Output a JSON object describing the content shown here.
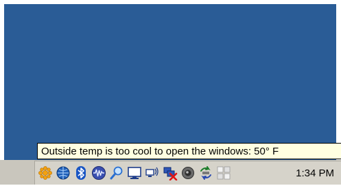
{
  "tooltip": {
    "text": "Outside temp is too cool to open the windows: 50° F"
  },
  "tray": {
    "clock": "1:34 PM",
    "icons": [
      "weather-sun-icon",
      "network-globe-icon",
      "bluetooth-icon",
      "audio-wave-icon",
      "search-magnifier-icon",
      "monitor-icon",
      "wireless-network-icon",
      "network-disconnected-icon",
      "volume-speaker-icon",
      "sync-icon",
      "grid-app-icon"
    ]
  },
  "colors": {
    "desktop": "#2a5c96",
    "tooltip_bg": "#ffffe1",
    "taskbar": "#d6d3ca"
  }
}
